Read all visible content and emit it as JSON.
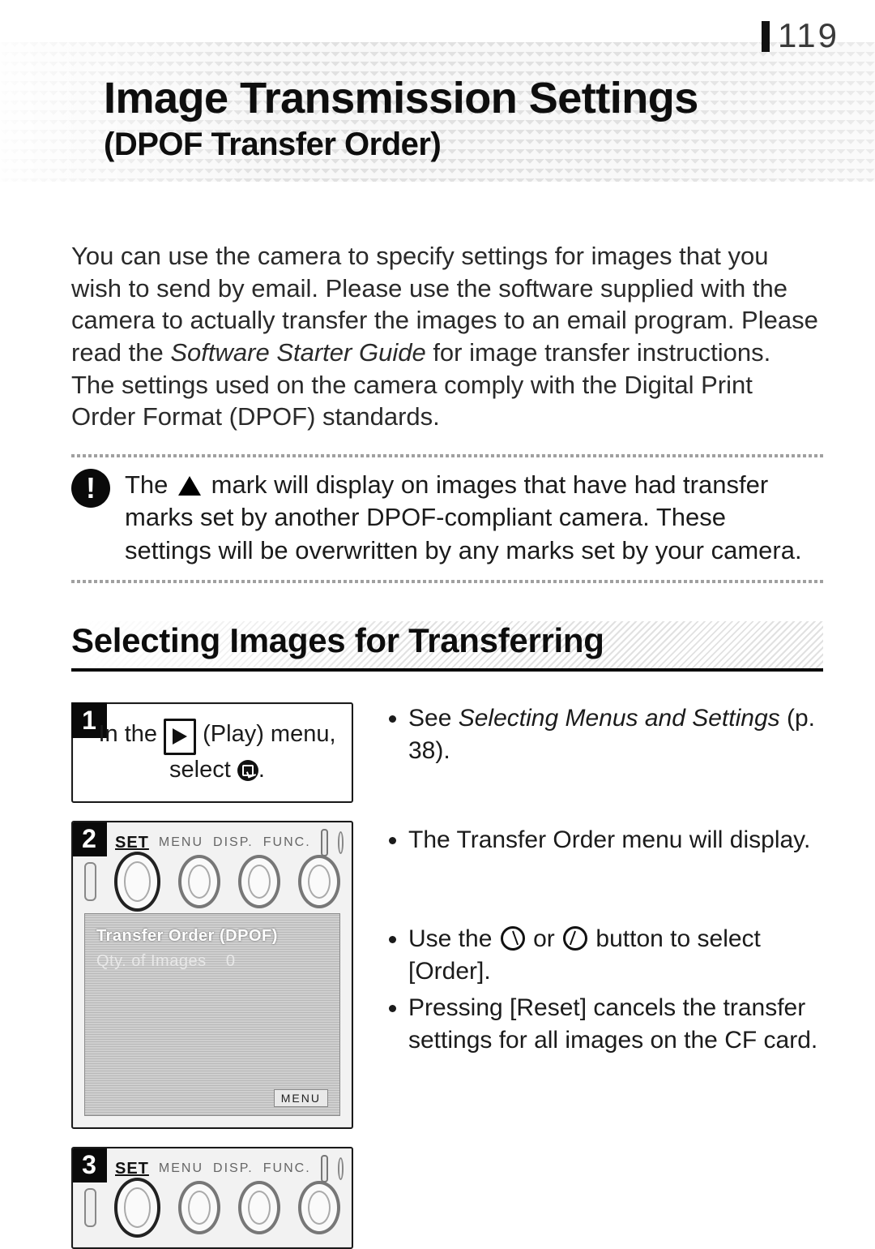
{
  "page_number": "119",
  "title": "Image Transmission Settings",
  "subtitle": "(DPOF Transfer Order)",
  "intro_html_parts": {
    "p1a": "You can use the camera to specify settings for images that you wish to send by email. Please use the software supplied with the camera to actually transfer the images to an email program. Please read the ",
    "p1_em": "Software Starter Guide",
    "p1b": " for image transfer instructions.",
    "p2": "The settings used on the camera comply with the Digital Print Order Format (DPOF) standards."
  },
  "callout": {
    "pre": "The ",
    "post": " mark will display on images that have had transfer marks set by another DPOF-compliant camera. These settings will be overwritten by any marks set by your camera."
  },
  "section_heading": "Selecting Images for Transferring",
  "steps": {
    "s1": {
      "num": "1",
      "line_a": "In the ",
      "play_label": "(Play)",
      "line_b": " menu,",
      "line_c": "select ",
      "line_d": "."
    },
    "s2": {
      "num": "2",
      "labels": {
        "set": "SET",
        "menu": "MENU",
        "disp": "DISP.",
        "func": "FUNC."
      },
      "screen": {
        "title": "Transfer Order (DPOF)",
        "qty_label": "Qty. of Images",
        "qty_value": "0",
        "menu_badge": "MENU"
      }
    },
    "s3": {
      "num": "3",
      "labels": {
        "set": "SET",
        "menu": "MENU",
        "disp": "DISP.",
        "func": "FUNC."
      }
    }
  },
  "right": {
    "g1_a": "See ",
    "g1_em": "Selecting Menus and Settings",
    "g1_b": " (p. 38).",
    "g2": "The Transfer Order menu will display.",
    "g3a_pre": "Use the ",
    "g3a_mid": " or ",
    "g3a_post": " button to select [Order].",
    "g3b": "Pressing [Reset] cancels the transfer settings for all images on the CF card."
  }
}
